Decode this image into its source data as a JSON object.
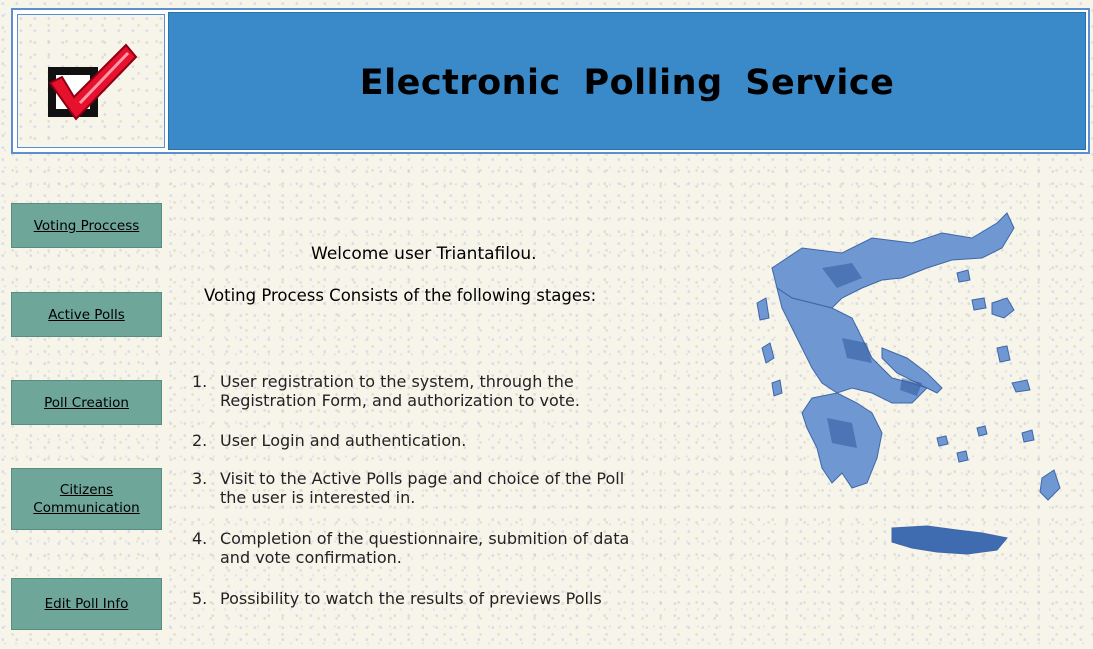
{
  "header": {
    "title": "Electronic  Polling  Service",
    "logo_icon": "checkbox-checkmark-icon"
  },
  "nav": {
    "items": [
      {
        "label": "Voting Proccess"
      },
      {
        "label": "Active Polls"
      },
      {
        "label": "Poll Creation"
      },
      {
        "label_line1": "Citizens",
        "label_line2": "Communication"
      },
      {
        "label": "Edit Poll Info"
      }
    ]
  },
  "main": {
    "welcome": "Welcome user Triantafilou.",
    "subtitle": "Voting Process Consists of the following stages:",
    "stages": [
      {
        "number": "1.",
        "line1": "User registration to the system, through the",
        "line2": "Registration Form, and authorization to vote."
      },
      {
        "number": "2.",
        "line1": "User Login and authentication.",
        "line2": ""
      },
      {
        "number": "3.",
        "line1": "Visit to the Active Polls page and choice of the Poll",
        "line2": "the user is interested in."
      },
      {
        "number": "4.",
        "line1": "Completion of the questionnaire, submition of data",
        "line2": "and vote confirmation."
      },
      {
        "number": "5.",
        "line1": "Possibility to watch the results of previews Polls",
        "line2": ""
      }
    ]
  },
  "map": {
    "image": "greece-map",
    "color": "#4a7cc4"
  },
  "colors": {
    "banner_blue": "#3a89c9",
    "nav_button": "#6fa69a",
    "page_background": "#f7f4ea"
  }
}
